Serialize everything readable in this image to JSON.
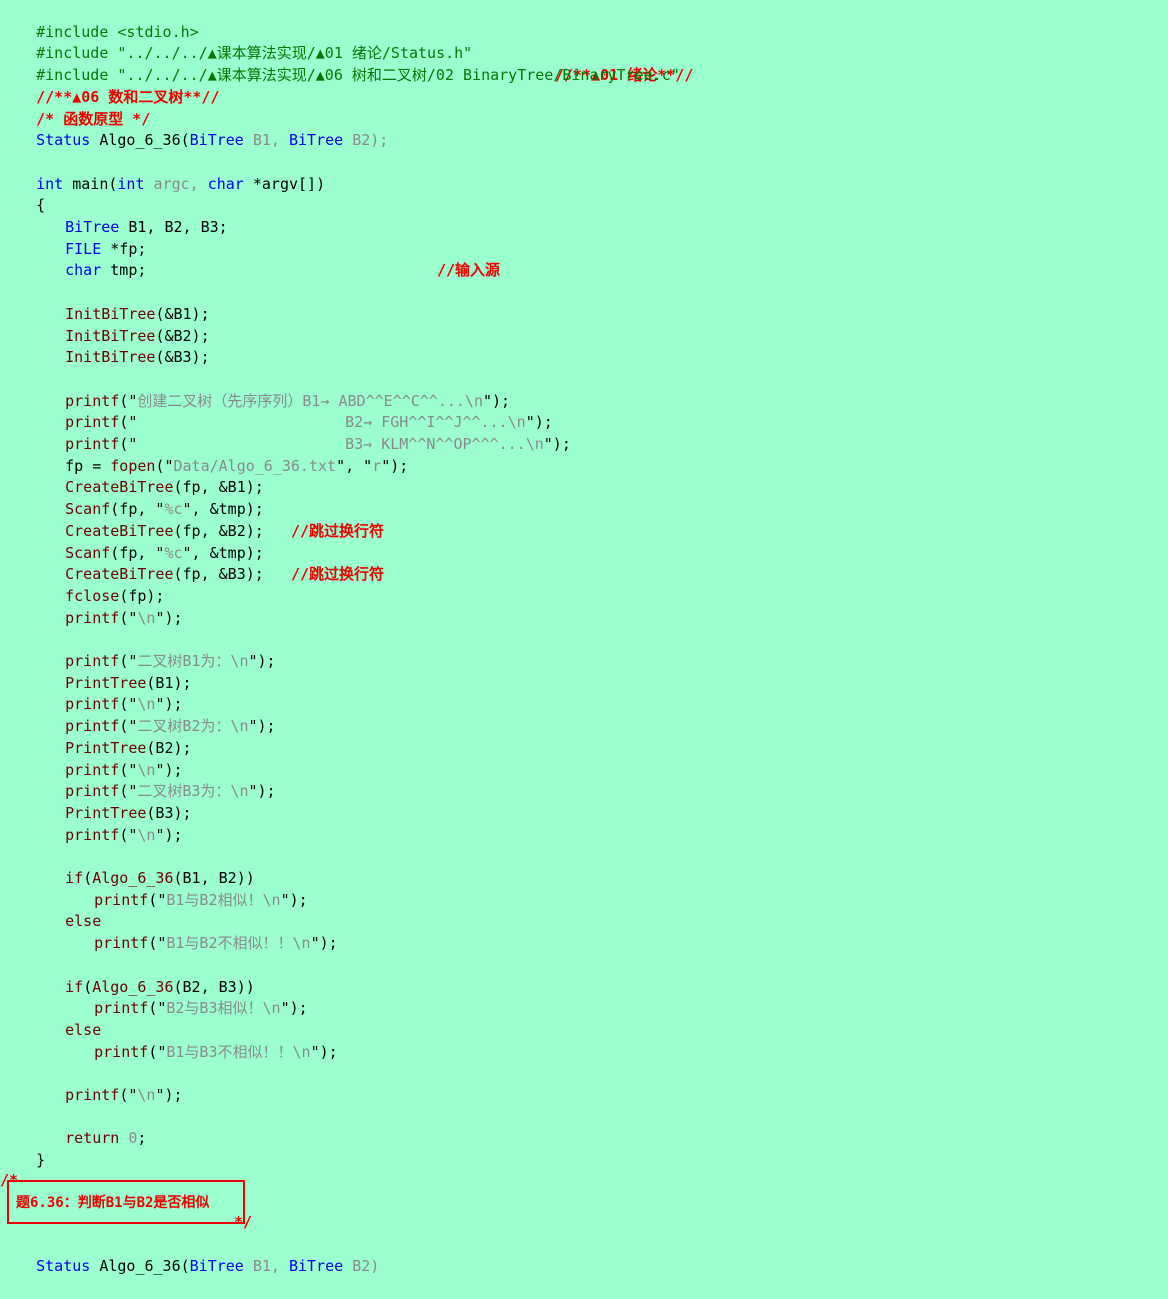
{
  "lines": [
    [
      "#include <stdio.h>"
    ],
    [
      "#include \"../../../▲课本算法实现/▲01 绪论/Status.h\"",
      "//**▲01 绪论**//"
    ],
    [
      "#include \"../../../▲课本算法实现/▲06 树和二叉树/02 BinaryTree/BinaryTree.c\"",
      "//**▲06 数和二叉树**//"
    ],
    [
      ""
    ],
    [
      "/* 函数原型 */"
    ],
    [
      "Status",
      " Algo_6_36(",
      "BiTree",
      " B1, ",
      "BiTree",
      " B2);"
    ],
    [
      ""
    ],
    [
      "int",
      " main(",
      "int",
      " argc, ",
      "char",
      " *argv[])"
    ],
    [
      "{"
    ],
    [
      "BiTree",
      " B1, B2, B3;"
    ],
    [
      "FILE",
      " *fp;",
      "//输入源"
    ],
    [
      "char",
      " tmp;"
    ],
    [
      ""
    ],
    [
      "InitBiTree",
      "(&B1);"
    ],
    [
      "InitBiTree",
      "(&B2);"
    ],
    [
      "InitBiTree",
      "(&B3);"
    ],
    [
      ""
    ],
    [
      "printf",
      "(\"",
      "创建二叉树（先序序列）B1→ ABD^^E^^C^^...\\n",
      "\");"
    ],
    [
      "printf",
      "(\"",
      "                       B2→ FGH^^I^^J^^...\\n",
      "\");"
    ],
    [
      "printf",
      "(\"",
      "                       B3→ KLM^^N^^OP^^^...\\n",
      "\");"
    ],
    [
      "fp = ",
      "fopen",
      "(\"",
      "Data/Algo_6_36.txt",
      "\", \"",
      "r",
      "\");"
    ],
    [
      "CreateBiTree",
      "(fp, &B1);"
    ],
    [
      "Scanf",
      "(fp, \"",
      "%c",
      "\", &tmp);",
      "//跳过换行符"
    ],
    [
      "CreateBiTree",
      "(fp, &B2);"
    ],
    [
      "Scanf",
      "(fp, \"",
      "%c",
      "\", &tmp);",
      "//跳过换行符"
    ],
    [
      "CreateBiTree",
      "(fp, &B3);"
    ],
    [
      "fclose",
      "(fp);"
    ],
    [
      "printf",
      "(\"",
      "\\n",
      "\");"
    ],
    [
      ""
    ],
    [
      "printf",
      "(\"",
      "二叉树B1为：\\n",
      "\");"
    ],
    [
      "PrintTree",
      "(B1);"
    ],
    [
      "printf",
      "(\"",
      "\\n",
      "\");"
    ],
    [
      "printf",
      "(\"",
      "二叉树B2为：\\n",
      "\");"
    ],
    [
      "PrintTree",
      "(B2);"
    ],
    [
      "printf",
      "(\"",
      "\\n",
      "\");"
    ],
    [
      "printf",
      "(\"",
      "二叉树B3为：\\n",
      "\");"
    ],
    [
      "PrintTree",
      "(B3);"
    ],
    [
      "printf",
      "(\"",
      "\\n",
      "\");"
    ],
    [
      ""
    ],
    [
      "if",
      "(",
      "Algo_6_36",
      "(B1, B2))"
    ],
    [
      "printf",
      "(\"",
      "B1与B2相似！\\n",
      "\");"
    ],
    [
      "else"
    ],
    [
      "printf",
      "(\"",
      "B1与B2不相似！！\\n",
      "\");"
    ],
    [
      ""
    ],
    [
      "if",
      "(",
      "Algo_6_36",
      "(B2, B3))"
    ],
    [
      "printf",
      "(\"",
      "B2与B3相似！\\n",
      "\");"
    ],
    [
      "else"
    ],
    [
      "printf",
      "(\"",
      "B1与B3不相似！！\\n",
      "\");"
    ],
    [
      ""
    ],
    [
      "printf",
      "(\"",
      "\\n",
      "\");"
    ],
    [
      ""
    ],
    [
      "return",
      " ",
      "0",
      ";"
    ],
    [
      "}"
    ],
    [
      ""
    ],
    [
      "/*"
    ],
    [
      "题6.36：判断B1与B2是否相似"
    ],
    [
      "*/"
    ],
    [
      "Status",
      " Algo_6_36(",
      "BiTree",
      " B1, ",
      "BiTree",
      " B2)"
    ]
  ]
}
